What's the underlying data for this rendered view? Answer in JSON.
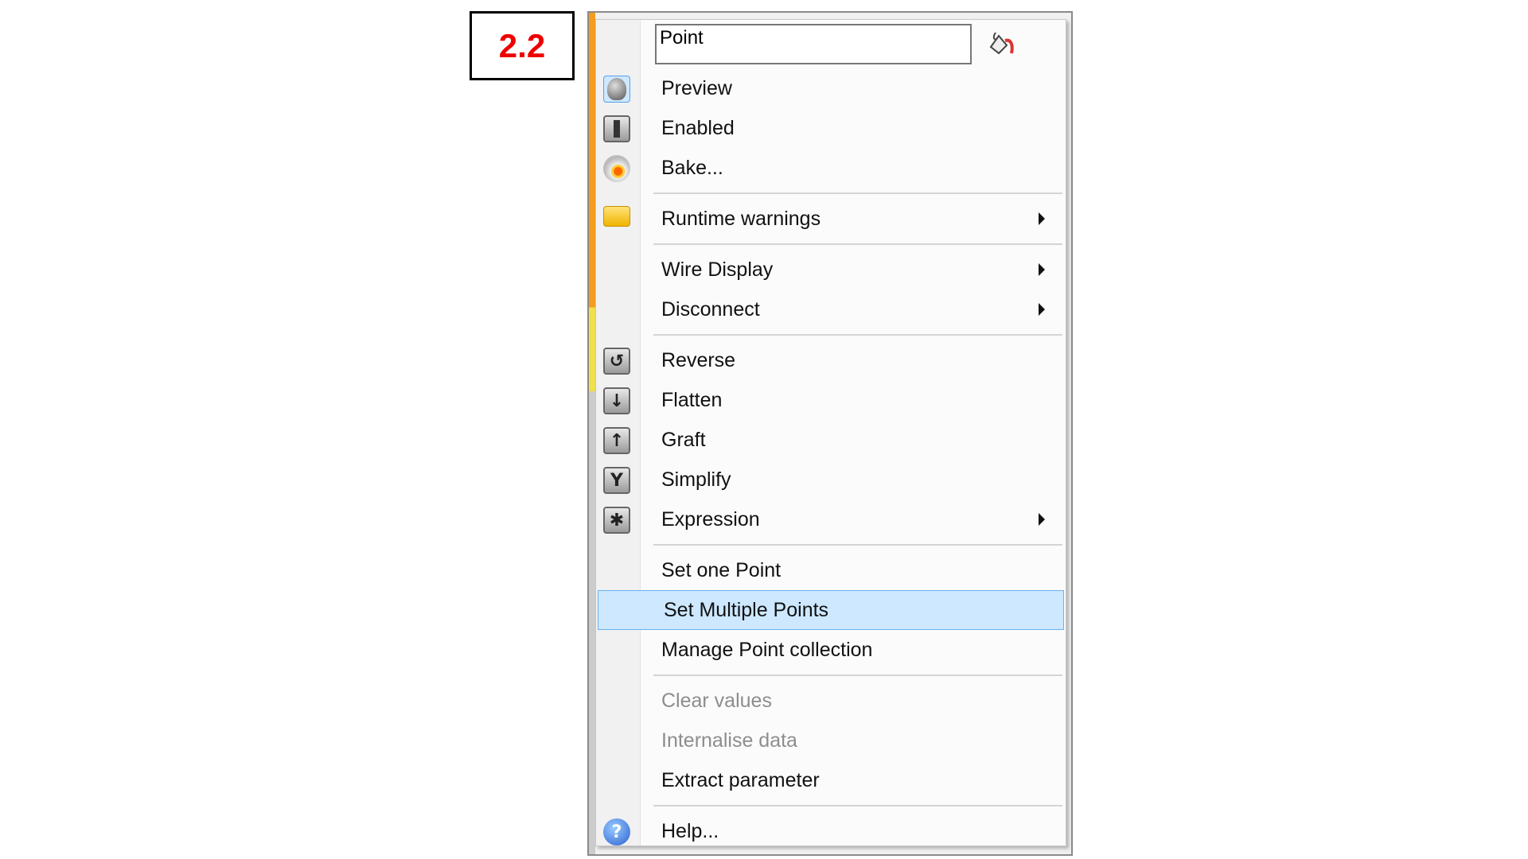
{
  "step_label": "2.2",
  "menu": {
    "name_field": {
      "value": "Point"
    },
    "groups": [
      [
        {
          "label": "Preview",
          "icon": "preview-icon",
          "selected_icon": true
        },
        {
          "label": "Enabled",
          "icon": "enabled-icon"
        },
        {
          "label": "Bake...",
          "icon": "bake-icon"
        }
      ],
      [
        {
          "label": "Runtime warnings",
          "icon": "warning-bubble-icon",
          "submenu": true
        }
      ],
      [
        {
          "label": "Wire Display",
          "submenu": true
        },
        {
          "label": "Disconnect",
          "submenu": true
        }
      ],
      [
        {
          "label": "Reverse",
          "icon": "reverse-icon"
        },
        {
          "label": "Flatten",
          "icon": "flatten-icon"
        },
        {
          "label": "Graft",
          "icon": "graft-icon"
        },
        {
          "label": "Simplify",
          "icon": "simplify-icon"
        },
        {
          "label": "Expression",
          "icon": "expression-icon",
          "submenu": true
        }
      ],
      [
        {
          "label": "Set one Point"
        },
        {
          "label": "Set Multiple Points",
          "highlighted": true
        },
        {
          "label": "Manage Point collection"
        }
      ],
      [
        {
          "label": "Clear values",
          "disabled": true
        },
        {
          "label": "Internalise data",
          "disabled": true
        },
        {
          "label": "Extract parameter"
        }
      ],
      [
        {
          "label": "Help...",
          "icon": "help-icon"
        }
      ]
    ]
  },
  "colors": {
    "highlight": "#cde8ff",
    "highlight_border": "#6ab0f0",
    "label": "#ee0000",
    "disabled": "#8d8d8d"
  }
}
